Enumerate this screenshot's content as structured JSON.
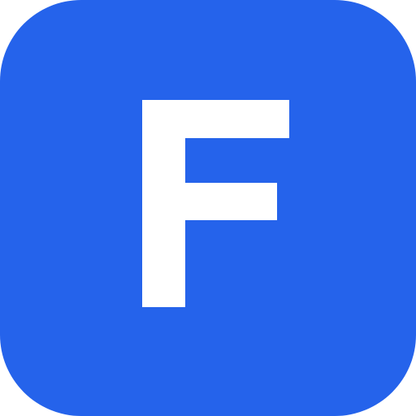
{
  "icon": {
    "name": "app-icon",
    "glyph": "F",
    "background_color": "#2563EB",
    "glyph_color": "#FFFFFF"
  }
}
